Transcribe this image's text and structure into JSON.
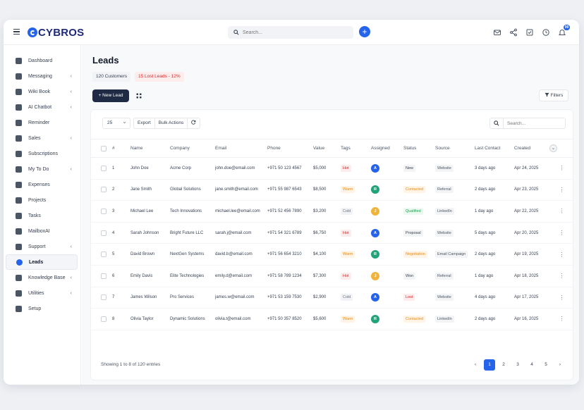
{
  "app": {
    "brand": "CYBROS"
  },
  "search": {
    "placeholder": "Search..."
  },
  "notifications": {
    "count": "99"
  },
  "sidebar": {
    "items": [
      {
        "label": "Dashboard",
        "icon": "dashboard-icon",
        "chevron": false
      },
      {
        "label": "Messaging",
        "icon": "chat-icon",
        "chevron": true
      },
      {
        "label": "Wiki Book",
        "icon": "book-icon",
        "chevron": true
      },
      {
        "label": "AI Chatbot",
        "icon": "bot-icon",
        "chevron": true
      },
      {
        "label": "Reminder",
        "icon": "bell-icon",
        "chevron": false
      },
      {
        "label": "Sales",
        "icon": "bolt-icon",
        "chevron": true
      },
      {
        "label": "Subscriptions",
        "icon": "refresh-icon",
        "chevron": false
      },
      {
        "label": "My To Do",
        "icon": "todo-icon",
        "chevron": true
      },
      {
        "label": "Expenses",
        "icon": "receipt-icon",
        "chevron": false
      },
      {
        "label": "Projects",
        "icon": "folder-icon",
        "chevron": false
      },
      {
        "label": "Tasks",
        "icon": "check-circle-icon",
        "chevron": false
      },
      {
        "label": "MailboxAI",
        "icon": "mail-icon",
        "chevron": false
      },
      {
        "label": "Support",
        "icon": "support-icon",
        "chevron": true
      },
      {
        "label": "Leads",
        "icon": "leads-icon",
        "chevron": false,
        "active": true
      },
      {
        "label": "Knowledge Base",
        "icon": "globe-icon",
        "chevron": true
      },
      {
        "label": "Utilities",
        "icon": "grid-icon",
        "chevron": true
      },
      {
        "label": "Setup",
        "icon": "gear-icon",
        "chevron": false
      }
    ]
  },
  "page": {
    "title": "Leads",
    "customers_chip": "120 Customers",
    "lost_chip": "15 Lost Leads - 12%",
    "new_lead_label": "+ New Lead",
    "filters_label": "Filters"
  },
  "toolbar": {
    "page_size": "25",
    "export_label": "Export",
    "bulk_label": "Bulk Actions",
    "search_placeholder": "Search..."
  },
  "table": {
    "columns": [
      "#",
      "Name",
      "Company",
      "Email",
      "Phone",
      "Value",
      "Tags",
      "Assigned",
      "Status",
      "Source",
      "Last Contact",
      "Created"
    ],
    "rows": [
      {
        "id": "1",
        "name": "John Doe",
        "company": "Acme Corp",
        "email": "john.doe@email.com",
        "phone": "+971 50 123 4567",
        "value": "$5,000",
        "tag": "Hot",
        "tag_class": "hot",
        "assigned": "A",
        "assigned_color": "#2563eb",
        "status": "New",
        "status_class": "new",
        "source": "Website",
        "last_contact": "3 days ago",
        "created": "Apr 24, 2025"
      },
      {
        "id": "2",
        "name": "Jane Smith",
        "company": "Global Solutions",
        "email": "jane.smith@email.com",
        "phone": "+971 55 987 6543",
        "value": "$8,500",
        "tag": "Warm",
        "tag_class": "warm",
        "assigned": "R",
        "assigned_color": "#22a37a",
        "status": "Contacted",
        "status_class": "contacted",
        "source": "Referral",
        "last_contact": "2 days ago",
        "created": "Apr 23, 2025"
      },
      {
        "id": "3",
        "name": "Michael Lee",
        "company": "Tech Innovations",
        "email": "michael.lee@email.com",
        "phone": "+971 52 456 7890",
        "value": "$3,200",
        "tag": "Cold",
        "tag_class": "cold",
        "assigned": "J",
        "assigned_color": "#f0b43c",
        "status": "Qualified",
        "status_class": "qualified",
        "source": "LinkedIn",
        "last_contact": "1 day ago",
        "created": "Apr 22, 2025"
      },
      {
        "id": "4",
        "name": "Sarah Johnson",
        "company": "Bright Future LLC",
        "email": "sarah.j@email.com",
        "phone": "+971 54 321 6789",
        "value": "$6,750",
        "tag": "Hot",
        "tag_class": "hot",
        "assigned": "A",
        "assigned_color": "#2563eb",
        "status": "Proposal",
        "status_class": "proposal",
        "source": "Website",
        "last_contact": "5 days ago",
        "created": "Apr 20, 2025"
      },
      {
        "id": "5",
        "name": "David Brown",
        "company": "NextGen Systems",
        "email": "david.b@email.com",
        "phone": "+971 56 654 3210",
        "value": "$4,100",
        "tag": "Warm",
        "tag_class": "warm",
        "assigned": "R",
        "assigned_color": "#22a37a",
        "status": "Negotiation",
        "status_class": "negotiation",
        "source": "Email Campaign",
        "last_contact": "2 days ago",
        "created": "Apr 19, 2025"
      },
      {
        "id": "6",
        "name": "Emily Davis",
        "company": "Elite Technologies",
        "email": "emily.d@email.com",
        "phone": "+971 58 789 1234",
        "value": "$7,300",
        "tag": "Hot",
        "tag_class": "hot",
        "assigned": "J",
        "assigned_color": "#f0b43c",
        "status": "Won",
        "status_class": "won",
        "source": "Referral",
        "last_contact": "1 day ago",
        "created": "Apr 18, 2025"
      },
      {
        "id": "7",
        "name": "James Wilson",
        "company": "Pro Services",
        "email": "james.w@email.com",
        "phone": "+971 53 159 7530",
        "value": "$2,900",
        "tag": "Cold",
        "tag_class": "cold",
        "assigned": "A",
        "assigned_color": "#2563eb",
        "status": "Lost",
        "status_class": "lost",
        "source": "Website",
        "last_contact": "4 days ago",
        "created": "Apr 17, 2025"
      },
      {
        "id": "8",
        "name": "Olivia Taylor",
        "company": "Dynamic Solutions",
        "email": "olivia.t@email.com",
        "phone": "+971 50 357 8520",
        "value": "$5,600",
        "tag": "Warm",
        "tag_class": "warm",
        "assigned": "R",
        "assigned_color": "#22a37a",
        "status": "Contacted",
        "status_class": "contacted",
        "source": "LinkedIn",
        "last_contact": "2 days ago",
        "created": "Apr 16, 2025"
      }
    ]
  },
  "footer": {
    "info": "Showing 1 to 8 of 120 entries",
    "pages": [
      "1",
      "2",
      "3",
      "4",
      "5"
    ],
    "active_page": "1"
  },
  "colors": {
    "accent": "#2563eb",
    "brand_dark": "#1e2a78",
    "button_dark": "#1f2a44"
  }
}
